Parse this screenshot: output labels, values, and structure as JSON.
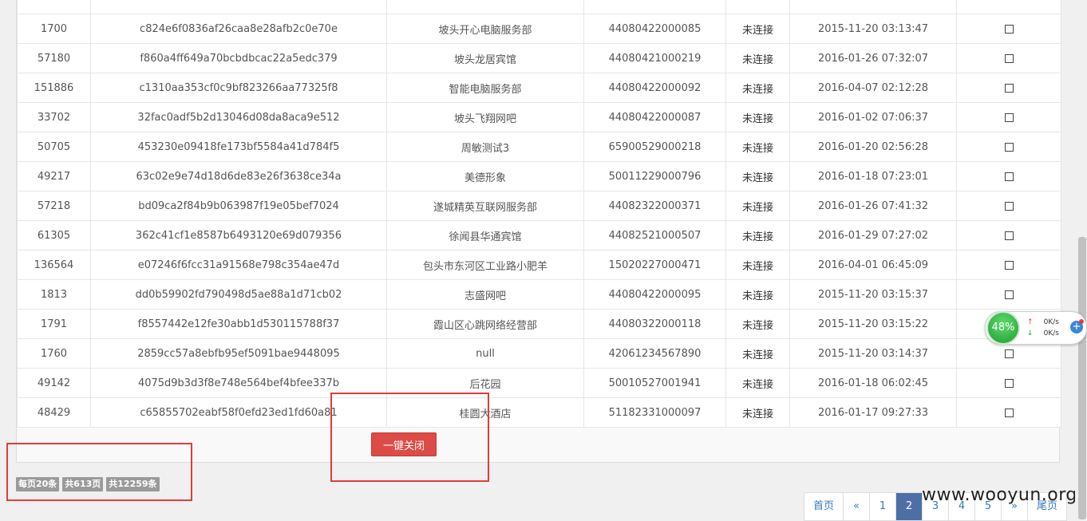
{
  "table": {
    "rows": [
      {
        "id": "",
        "hash": "",
        "name": "",
        "code": "",
        "status": "",
        "time": ""
      },
      {
        "id": "1700",
        "hash": "c824e6f0836af26caa8e28afb2c0e70e",
        "name": "坡头开心电脑服务部",
        "code": "44080422000085",
        "status": "未连接",
        "time": "2015-11-20 03:13:47"
      },
      {
        "id": "57180",
        "hash": "f860a4ff649a70bcbdbcac22a5edc379",
        "name": "坡头龙居宾馆",
        "code": "44080421000219",
        "status": "未连接",
        "time": "2016-01-26 07:32:07"
      },
      {
        "id": "151886",
        "hash": "c1310aa353cf0c9bf823266aa77325f8",
        "name": "智能电脑服务部",
        "code": "44080422000092",
        "status": "未连接",
        "time": "2016-04-07 02:12:28"
      },
      {
        "id": "33702",
        "hash": "32fac0adf5b2d13046d08da8aca9e512",
        "name": "坡头飞翔网吧",
        "code": "44080422000087",
        "status": "未连接",
        "time": "2016-01-02 07:06:37"
      },
      {
        "id": "50705",
        "hash": "453230e09418fe173bf5584a41d784f5",
        "name": "周敏测试3",
        "code": "65900529000218",
        "status": "未连接",
        "time": "2016-01-20 02:56:28"
      },
      {
        "id": "49217",
        "hash": "63c02e9e74d18d6de83e26f3638ce34a",
        "name": "美德形象",
        "code": "50011229000796",
        "status": "未连接",
        "time": "2016-01-18 07:23:01"
      },
      {
        "id": "57218",
        "hash": "bd09ca2f84b9b063987f19e05bef7024",
        "name": "遂城精英互联网服务部",
        "code": "44082322000371",
        "status": "未连接",
        "time": "2016-01-26 07:41:32"
      },
      {
        "id": "61305",
        "hash": "362c41cf1e8587b6493120e69d079356",
        "name": "徐闻县华通宾馆",
        "code": "44082521000507",
        "status": "未连接",
        "time": "2016-01-29 07:27:02"
      },
      {
        "id": "136564",
        "hash": "e07246f6fcc31a91568e798c354ae47d",
        "name": "包头市东河区工业路小肥羊",
        "code": "15020227000471",
        "status": "未连接",
        "time": "2016-04-01 06:45:09"
      },
      {
        "id": "1813",
        "hash": "dd0b59902fd790498d5ae88a1d71cb02",
        "name": "志盛网吧",
        "code": "44080422000095",
        "status": "未连接",
        "time": "2015-11-20 03:15:37"
      },
      {
        "id": "1791",
        "hash": "f8557442e12fe30abb1d530115788f37",
        "name": "霞山区心跳网络经营部",
        "code": "44080322000118",
        "status": "未连接",
        "time": "2015-11-20 03:15:22"
      },
      {
        "id": "1760",
        "hash": "2859cc57a8ebfb95ef5091bae9448095",
        "name": "null",
        "code": "42061234567890",
        "status": "未连接",
        "time": "2015-11-20 03:14:37"
      },
      {
        "id": "49142",
        "hash": "4075d9b3d3f8e748e564bef4bfee337b",
        "name": "后花园",
        "code": "50010527001941",
        "status": "未连接",
        "time": "2016-01-18 06:02:45"
      },
      {
        "id": "48429",
        "hash": "c65855702eabf58f0efd23ed1fd60a81",
        "name": "桂圆大酒店",
        "code": "51182331000097",
        "status": "未连接",
        "time": "2016-01-17 09:27:33"
      }
    ]
  },
  "actions": {
    "close_all_label": "一键关闭"
  },
  "stats": {
    "per_page": "每页20条",
    "total_pages": "共613页",
    "total_items": "共12259条"
  },
  "pagination": {
    "items": [
      "首页",
      "«",
      "1",
      "2",
      "3",
      "4",
      "5",
      "»",
      "尾页"
    ],
    "active": "2"
  },
  "watermark": {
    "text": "www.wooyun.org"
  },
  "net_monitor": {
    "percent": "48%",
    "up_speed": "0K/s",
    "down_speed": "0K/s"
  }
}
